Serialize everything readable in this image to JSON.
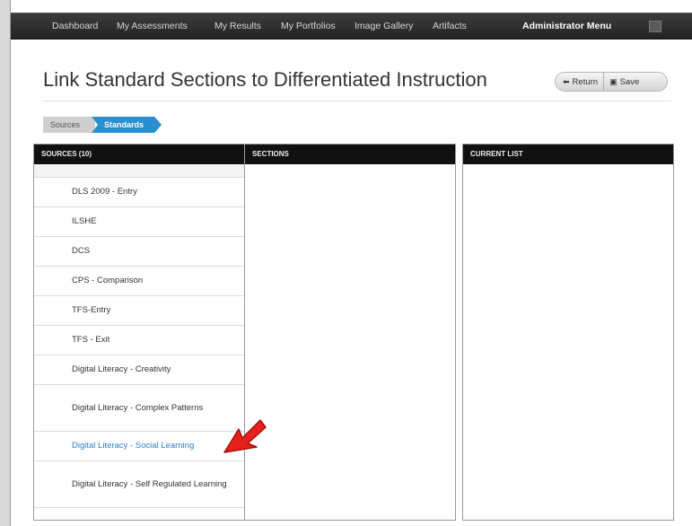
{
  "nav": {
    "items": [
      "Dashboard",
      "My Assessments",
      "My Results",
      "My Portfolios",
      "Image Gallery",
      "Artifacts"
    ],
    "admin": "Administrator Menu"
  },
  "page": {
    "title": "Link Standard Sections to Differentiated Instruction",
    "return_label": "Return",
    "save_label": "Save"
  },
  "breadcrumb": {
    "sources": "Sources",
    "standards": "Standards"
  },
  "panels": {
    "sources_header": "SOURCES (10)",
    "sections_header": "SECTIONS",
    "current_header": "CURRENT LIST"
  },
  "sources": [
    "DLS 2009 - Entry",
    "ILSHE",
    "DCS",
    "CPS - Comparison",
    "TFS-Entry",
    "TFS - Exit",
    "Digital Literacy - Creativity",
    "Digital Literacy - Complex Patterns",
    "Digital Literacy - Social Learning",
    "Digital Literacy - Self Regulated Learning"
  ],
  "selected_source": "Digital Literacy - Social Learning",
  "colors": {
    "accent": "#2a8fd1",
    "arrow": "#e8201c",
    "navbar": "#2b2b2b"
  }
}
